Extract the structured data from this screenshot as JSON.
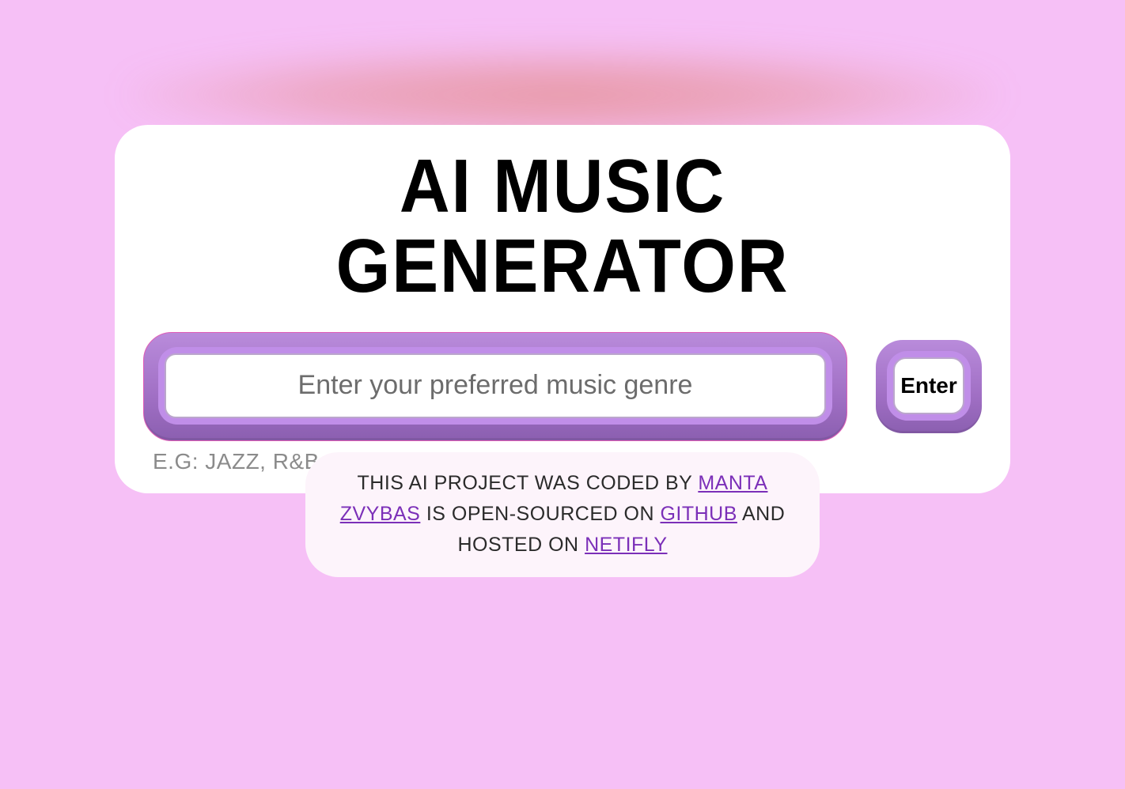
{
  "header": {
    "title": "AI Music Generator"
  },
  "form": {
    "genre_input": {
      "value": "",
      "placeholder": "Enter your preferred music genre"
    },
    "submit_label": "Enter",
    "hint": "e.g: Jazz, R&B, Pop..."
  },
  "footer": {
    "prefix": "This AI project was coded by ",
    "author": "Manta Zvybas",
    "mid1": " is open-sourced on ",
    "link_github": "GitHub",
    "mid2": " and hosted on ",
    "link_host": "Netifly"
  }
}
